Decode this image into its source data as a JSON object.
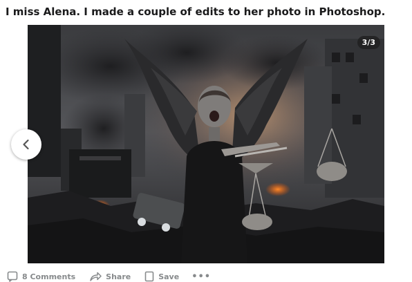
{
  "post": {
    "title": "I miss Alena. I made a couple of edits to her photo in Photoshop."
  },
  "gallery": {
    "counter": "3/3",
    "image_alt": "Dark apocalyptic city scene with a winged woman holding scales"
  },
  "actions": {
    "comments_label": "8 Comments",
    "share_label": "Share",
    "save_label": "Save",
    "more_label": "•••"
  },
  "icons": {
    "prev": "chevron-left-icon",
    "comments": "comment-icon",
    "share": "share-icon",
    "save": "bookmark-icon",
    "more": "more-icon"
  },
  "colors": {
    "title_text": "#1a1a1b",
    "action_text": "#878a8c",
    "counter_bg": "#1c1c1c"
  }
}
